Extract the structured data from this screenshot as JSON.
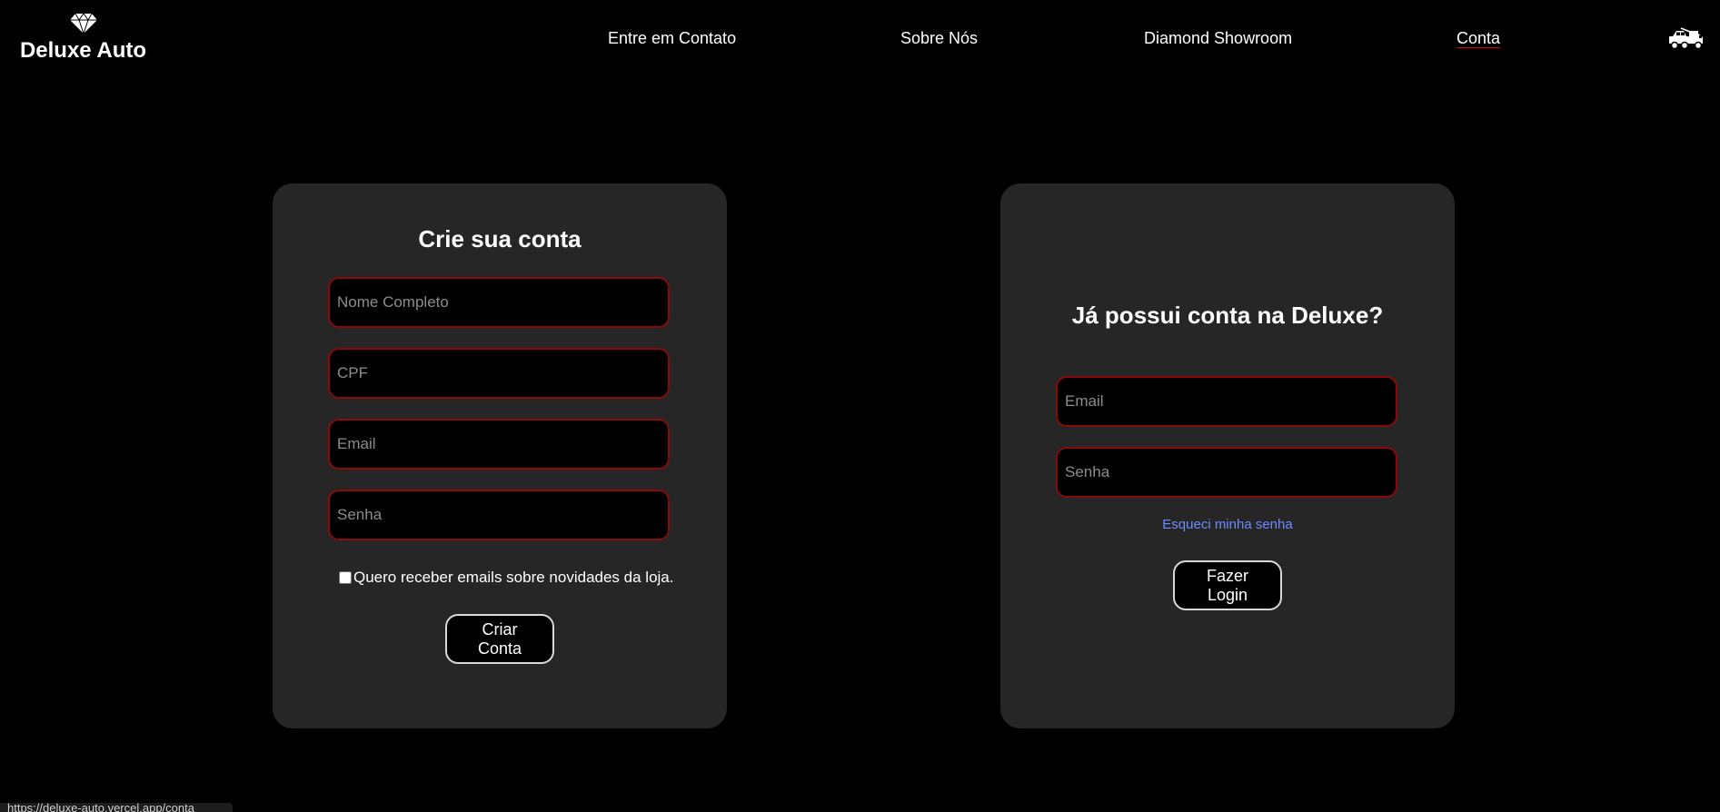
{
  "brand": {
    "name": "Deluxe Auto",
    "logo_icon": "diamond-icon"
  },
  "nav": {
    "items": [
      {
        "label": "Entre em Contato"
      },
      {
        "label": "Sobre Nós"
      },
      {
        "label": "Diamond Showroom"
      },
      {
        "label": "Conta",
        "active": true
      }
    ],
    "cart_icon": "tow-truck-icon"
  },
  "signup": {
    "title": "Crie sua conta",
    "fields": {
      "name_placeholder": "Nome Completo",
      "cpf_placeholder": "CPF",
      "email_placeholder": "Email",
      "password_placeholder": "Senha"
    },
    "newsletter_label": "Quero receber emails sobre novidades da loja.",
    "submit_label": "Criar Conta"
  },
  "login": {
    "title": "Já possui conta na Deluxe?",
    "fields": {
      "email_placeholder": "Email",
      "password_placeholder": "Senha"
    },
    "forgot_label": "Esqueci minha senha",
    "submit_label": "Fazer Login"
  },
  "status_bar": {
    "url": "https://deluxe-auto.vercel.app/conta"
  },
  "colors": {
    "background": "#000000",
    "card": "#262626",
    "input_border": "#8a0a0a",
    "link": "#6b8cff",
    "active_underline": "#d40000"
  }
}
